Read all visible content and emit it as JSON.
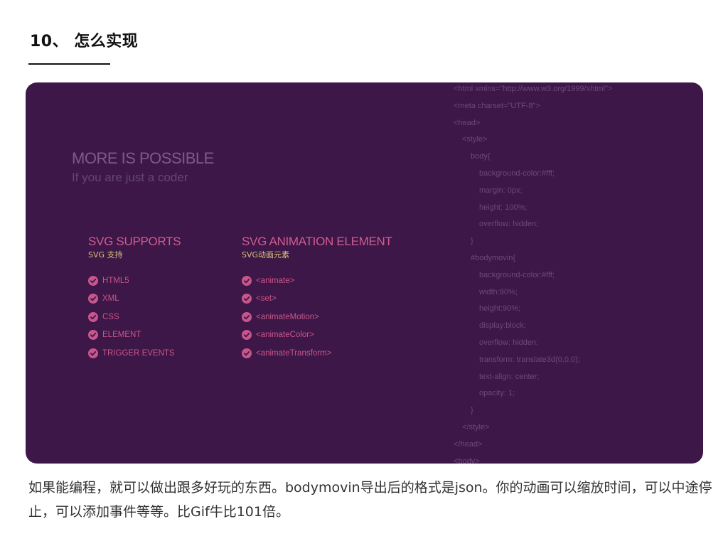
{
  "section_heading": "10、 怎么实现",
  "panel": {
    "title": "MORE IS POSSIBLE",
    "subtitle": "If you are just a coder",
    "columns": [
      {
        "title": "SVG  SUPPORTS",
        "subtitle": "SVG 支持",
        "items": [
          "HTML5",
          "XML",
          "CSS",
          "ELEMENT",
          "TRIGGER EVENTS"
        ]
      },
      {
        "title": "SVG  ANIMATION ELEMENT",
        "subtitle": "SVG动画元素",
        "items": [
          "<animate>",
          "<set>",
          "<animateMotion>",
          "<animateColor>",
          "<animateTransform>"
        ]
      }
    ],
    "code_lines": [
      {
        "indent": 0,
        "text": "<html xmlns=\"http://www.w3.org/1999/xhtml\">"
      },
      {
        "indent": 0,
        "text": "<meta charset=\"UTF-8\">"
      },
      {
        "indent": 0,
        "text": "<head>"
      },
      {
        "indent": 1,
        "text": "<style>"
      },
      {
        "indent": 2,
        "text": "body{"
      },
      {
        "indent": 3,
        "text": "background-color:#fff;"
      },
      {
        "indent": 3,
        "text": "margin: 0px;"
      },
      {
        "indent": 3,
        "text": "height: 100%;"
      },
      {
        "indent": 3,
        "text": "overflow: hidden;"
      },
      {
        "indent": 2,
        "text": "}"
      },
      {
        "indent": 2,
        "text": "#bodymovin{"
      },
      {
        "indent": 3,
        "text": "background-color:#fff;"
      },
      {
        "indent": 3,
        "text": "width:90%;"
      },
      {
        "indent": 3,
        "text": "height:90%;"
      },
      {
        "indent": 3,
        "text": "display:block;"
      },
      {
        "indent": 3,
        "text": "overflow: hidden;"
      },
      {
        "indent": 3,
        "text": "transform: translate3d(0,0,0);"
      },
      {
        "indent": 3,
        "text": "text-align: center;"
      },
      {
        "indent": 3,
        "text": "opacity: 1;"
      },
      {
        "indent": 2,
        "text": "}"
      },
      {
        "indent": 1,
        "text": "</style>"
      },
      {
        "indent": 0,
        "text": "</head>"
      },
      {
        "indent": 0,
        "text": "<body>"
      }
    ],
    "check_icon": "check-circle-icon",
    "colors": {
      "background": "#3d1747",
      "accent_pink": "#d15c92",
      "accent_gold": "#d7c37a",
      "muted_purple": "#7d5a8e"
    }
  },
  "caption": "如果能编程，就可以做出跟多好玩的东西。bodymovin导出后的格式是json。你的动画可以缩放时间，可以中途停止，可以添加事件等等。比Gif牛比101倍。"
}
